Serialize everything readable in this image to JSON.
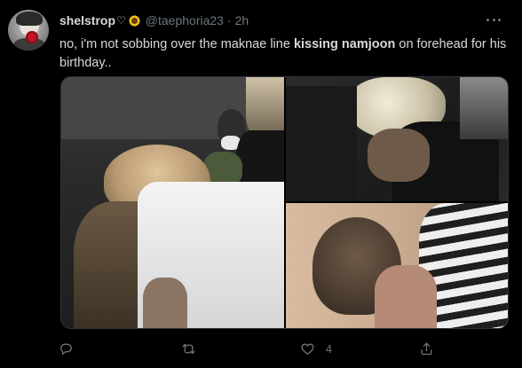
{
  "tweet": {
    "display_name": "shelstrop",
    "name_heart": "♡",
    "handle": "@taephoria23",
    "separator": "·",
    "time": "2h",
    "text_part1": "no, i'm not sobbing over the maknae line ",
    "text_bold": "kissing namjoon",
    "text_part2": " on forehead for his birthday.."
  },
  "actions": {
    "reply_count": "",
    "retweet_count": "",
    "like_count": "4",
    "share_count": ""
  },
  "colors": {
    "background": "#000000",
    "text": "#d9d9d9",
    "muted": "#6e767d",
    "border": "#2f3336"
  },
  "icons": [
    "more-icon",
    "reply-icon",
    "retweet-icon",
    "like-icon",
    "share-icon",
    "sunflower-emoji"
  ]
}
